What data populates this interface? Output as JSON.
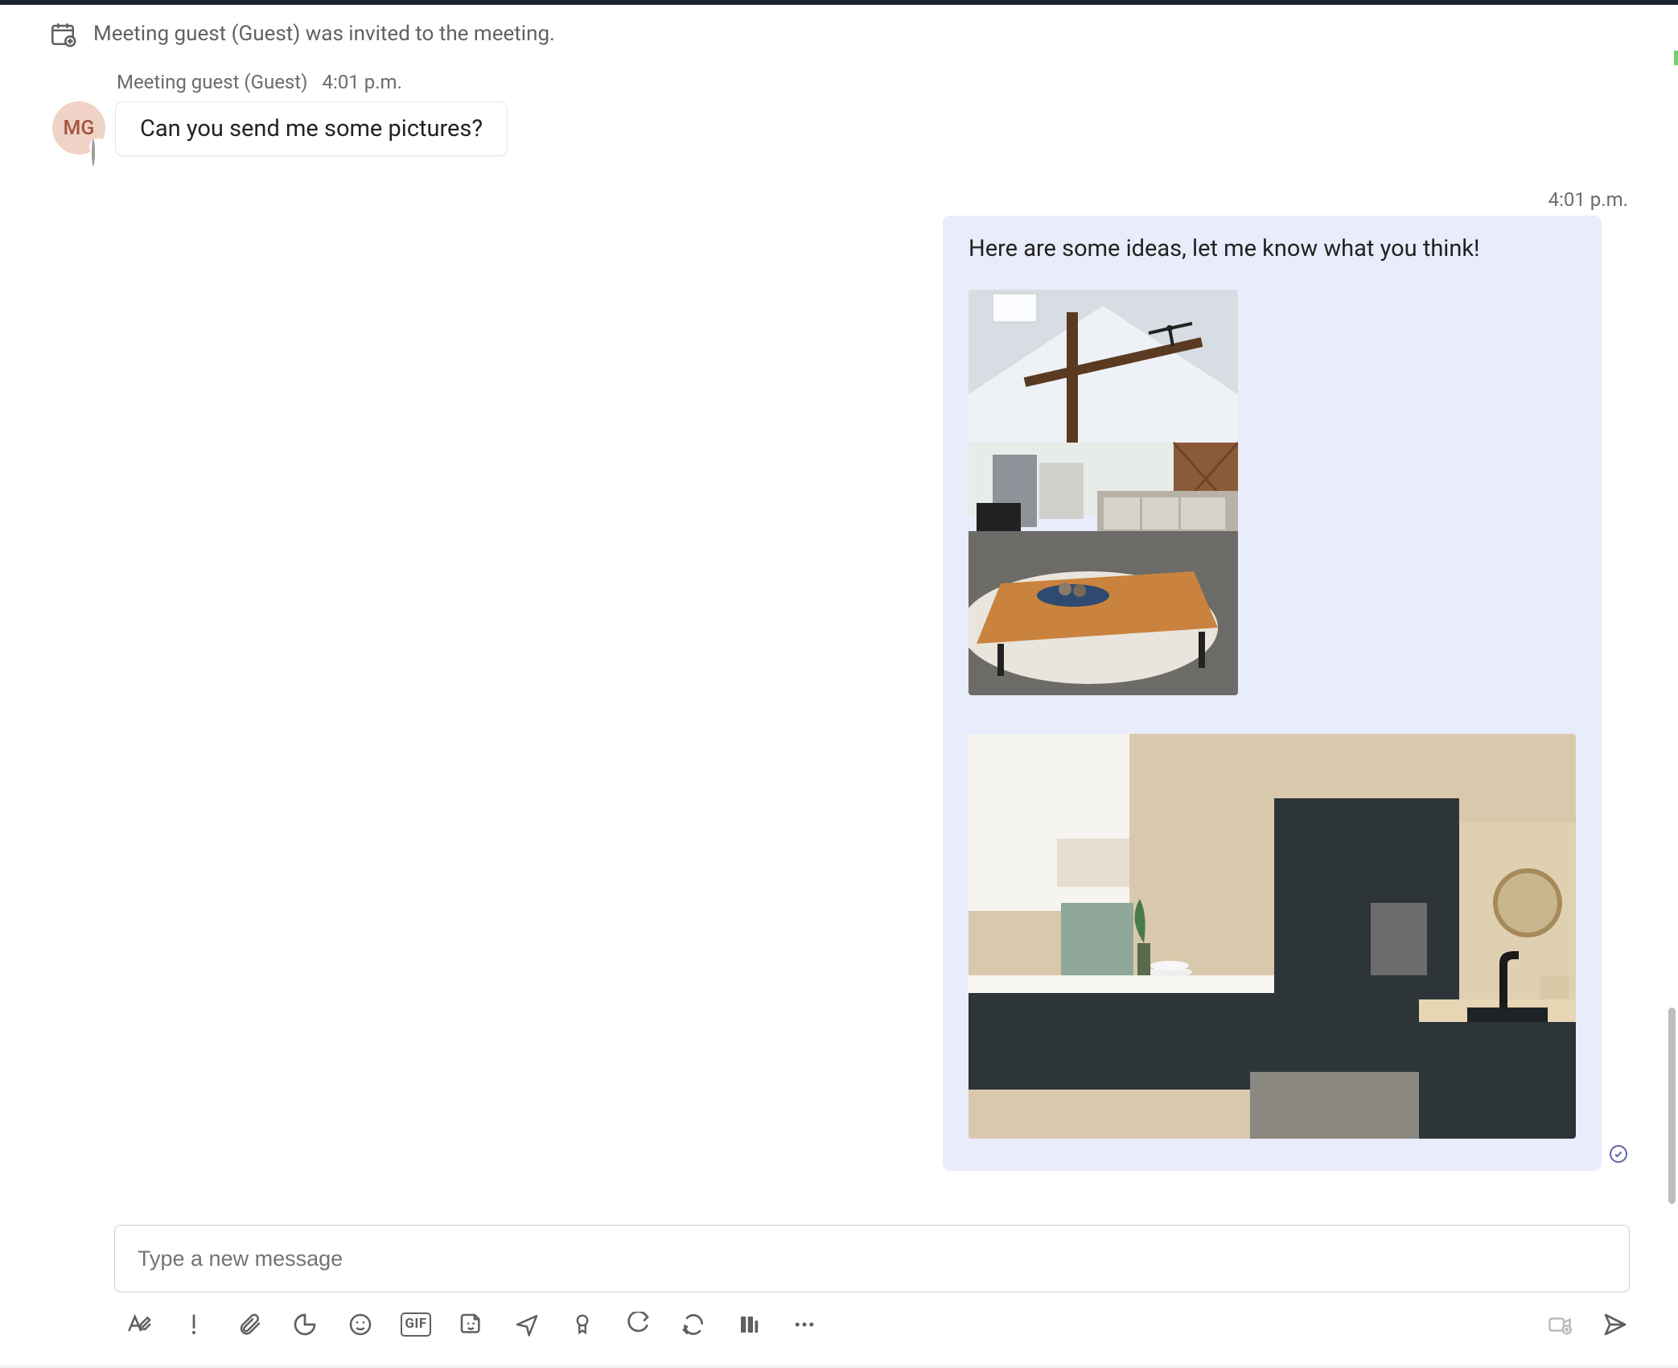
{
  "system": {
    "calendar_icon": "calendar-plus-icon",
    "invite_text": "Meeting guest (Guest) was invited to the meeting."
  },
  "incoming": {
    "avatar_initials": "MG",
    "sender_label": "Meeting guest (Guest)",
    "time": "4:01 p.m.",
    "text": "Can you send me some pictures?"
  },
  "outgoing": {
    "time": "4:01 p.m.",
    "text": "Here are some ideas, let me know what you think!"
  },
  "compose": {
    "placeholder": "Type a new message"
  },
  "toolbar": {
    "gif_label": "GIF"
  },
  "colors": {
    "outgoing_bubble": "#e9ecfa",
    "accent": "#6264a7"
  }
}
